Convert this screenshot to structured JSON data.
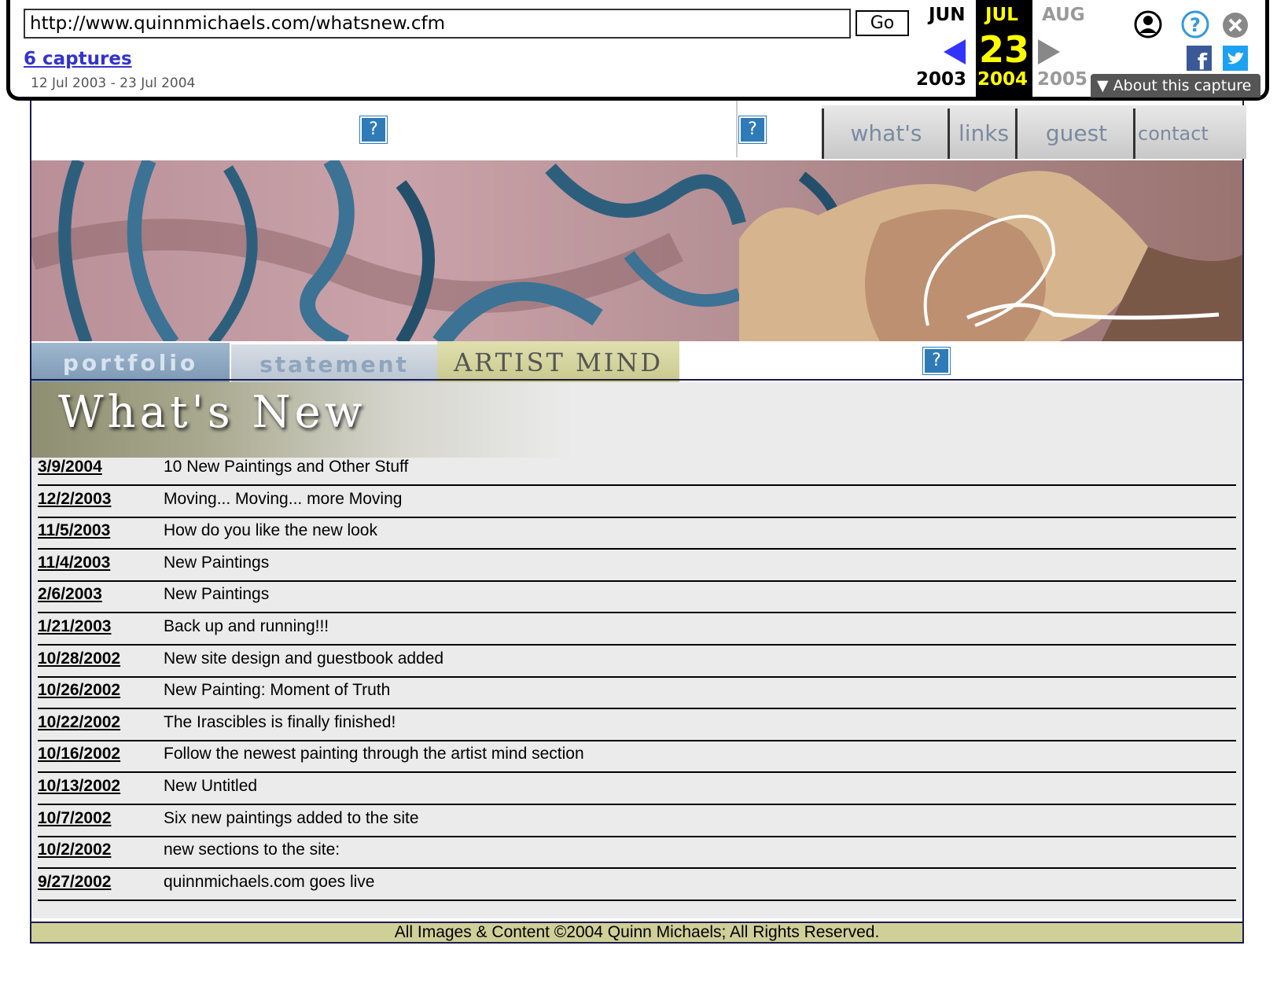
{
  "wayback": {
    "url": "http://www.quinnmichaels.com/whatsnew.cfm",
    "go_label": "Go",
    "captures_label": "6 captures",
    "date_range": "12 Jul 2003 - 23 Jul 2004",
    "prev_month": "JUN",
    "cur_month": "JUL",
    "next_month": "AUG",
    "day": "23",
    "prev_year": "2003",
    "cur_year": "2004",
    "next_year": "2005",
    "about_label": "About this capture",
    "colors": {
      "highlight": "#ffff00",
      "prev_arrow": "#3333ff",
      "next_arrow": "#888888"
    }
  },
  "nav": {
    "whats_new": "what's new",
    "links": "links",
    "guest_book": "guest book",
    "contact": "contact"
  },
  "subtabs": {
    "portfolio": "portfolio",
    "statement": "statement",
    "artist_mind": "ARTIST MIND"
  },
  "placeholder_glyph": "?",
  "page": {
    "heading": "What's New"
  },
  "news": [
    {
      "date": "3/9/2004",
      "title": "10 New Paintings and Other Stuff"
    },
    {
      "date": "12/2/2003",
      "title": "Moving... Moving... more Moving"
    },
    {
      "date": "11/5/2003",
      "title": "How do you like the new look"
    },
    {
      "date": "11/4/2003",
      "title": "New Paintings"
    },
    {
      "date": "2/6/2003",
      "title": "New Paintings"
    },
    {
      "date": "1/21/2003",
      "title": "Back up and running!!!"
    },
    {
      "date": "10/28/2002",
      "title": "New site design and guestbook added"
    },
    {
      "date": "10/26/2002",
      "title": "New Painting: Moment of Truth"
    },
    {
      "date": "10/22/2002",
      "title": "The Irascibles is finally finished!"
    },
    {
      "date": "10/16/2002",
      "title": "Follow the newest painting through the artist mind section"
    },
    {
      "date": "10/13/2002",
      "title": "New Untitled"
    },
    {
      "date": "10/7/2002",
      "title": "Six new paintings added to the site"
    },
    {
      "date": "10/2/2002",
      "title": "new sections to the site:"
    },
    {
      "date": "9/27/2002",
      "title": "quinnmichaels.com goes live"
    }
  ],
  "footer": "All Images & Content ©2004 Quinn Michaels; All Rights Reserved."
}
